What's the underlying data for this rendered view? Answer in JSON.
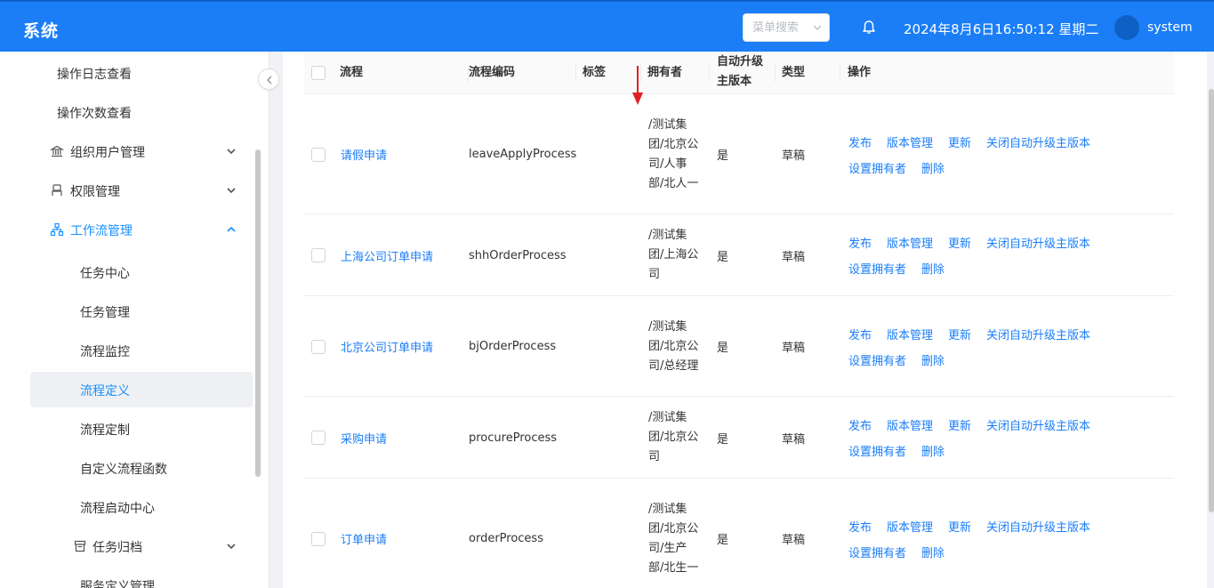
{
  "header": {
    "brand": "系统",
    "search_placeholder": "菜单搜索",
    "datetime": "2024年8月6日16:50:12 星期二",
    "username": "system"
  },
  "sidebar": {
    "items": [
      {
        "label": "操作日志查看"
      },
      {
        "label": "操作次数查看"
      },
      {
        "label": "组织用户管理",
        "icon": "bank-icon"
      },
      {
        "label": "权限管理",
        "icon": "user-icon"
      },
      {
        "label": "工作流管理",
        "icon": "sitemap-icon"
      },
      {
        "label": "任务中心"
      },
      {
        "label": "任务管理"
      },
      {
        "label": "流程监控"
      },
      {
        "label": "流程定义"
      },
      {
        "label": "流程定制"
      },
      {
        "label": "自定义流程函数"
      },
      {
        "label": "流程启动中心"
      },
      {
        "label": "任务归档",
        "icon": "archive-icon"
      },
      {
        "label": "服务定义管理"
      }
    ]
  },
  "table": {
    "columns": {
      "name": "流程",
      "code": "流程编码",
      "tag": "标签",
      "owner": "拥有者",
      "auto_upgrade": "自动升级主版本",
      "type": "类型",
      "actions": "操作"
    },
    "rows": [
      {
        "name": "请假申请",
        "code": "leaveApplyProcess",
        "tag": "",
        "owner": "/测试集团/北京公司/人事部/北人一",
        "auto_upgrade": "是",
        "type": "草稿"
      },
      {
        "name": "上海公司订单申请",
        "code": "shhOrderProcess",
        "tag": "",
        "owner": "/测试集团/上海公司",
        "auto_upgrade": "是",
        "type": "草稿"
      },
      {
        "name": "北京公司订单申请",
        "code": "bjOrderProcess",
        "tag": "",
        "owner": "/测试集团/北京公司/总经理",
        "auto_upgrade": "是",
        "type": "草稿"
      },
      {
        "name": "采购申请",
        "code": "procureProcess",
        "tag": "",
        "owner": "/测试集团/北京公司",
        "auto_upgrade": "是",
        "type": "草稿"
      },
      {
        "name": "订单申请",
        "code": "orderProcess",
        "tag": "",
        "owner": "/测试集团/北京公司/生产部/北生一",
        "auto_upgrade": "是",
        "type": "草稿"
      }
    ],
    "actions": {
      "publish": "发布",
      "versions": "版本管理",
      "update": "更新",
      "disable_auto_upgrade": "关闭自动升级主版本",
      "set_owner": "设置拥有者",
      "delete": "删除"
    }
  },
  "colors": {
    "primary": "#1b7ef7",
    "annotation_arrow": "#e02020"
  }
}
